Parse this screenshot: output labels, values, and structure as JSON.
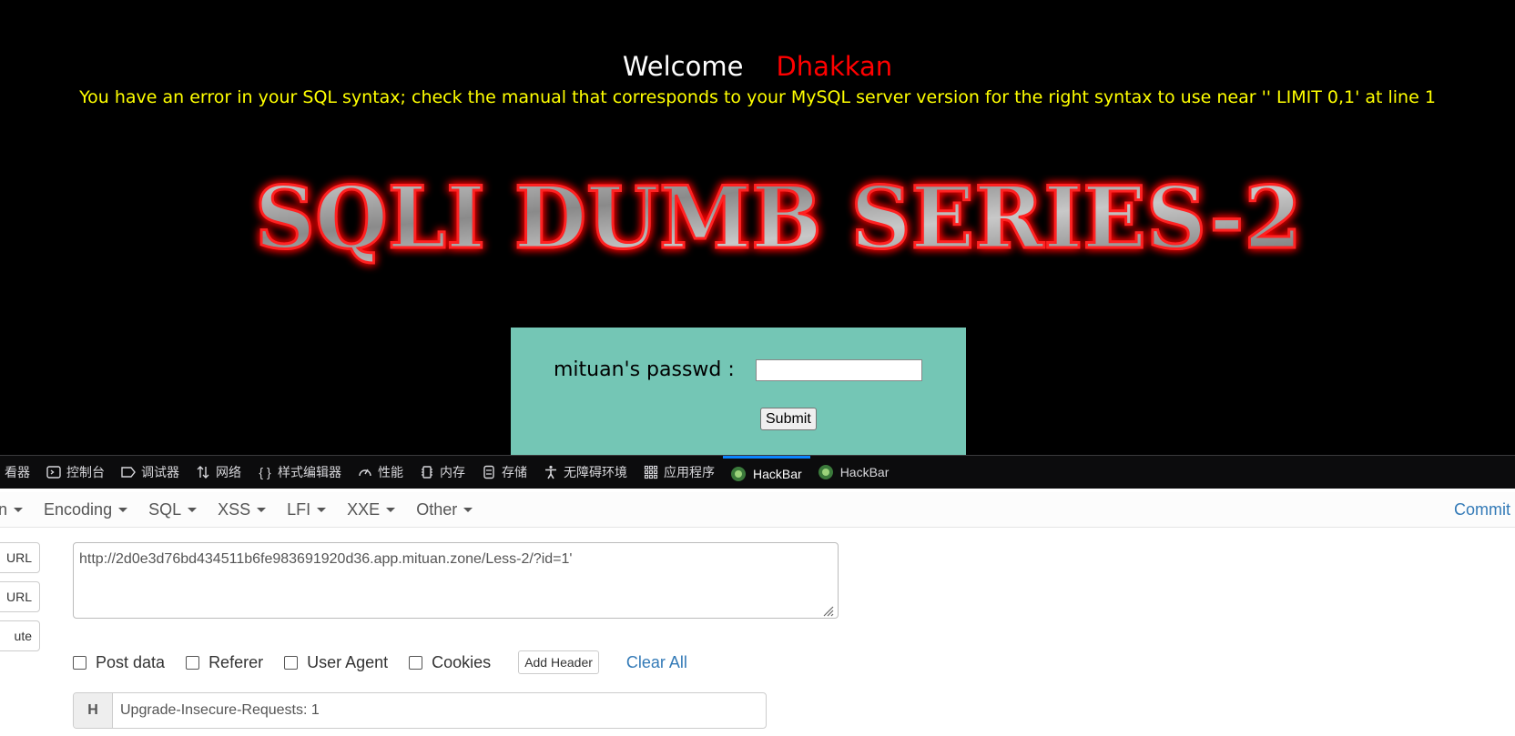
{
  "page": {
    "welcome": "Welcome",
    "user": "Dhakkan",
    "sql_error": "You have an error in your SQL syntax; check the manual that corresponds to your MySQL server version for the right syntax to use near '' LIMIT 0,1' at line 1",
    "logo_text": "SQLI DUMB SERIES-2",
    "passwd_label": "mituan's passwd :",
    "passwd_value": "",
    "submit_label": "Submit"
  },
  "devtools": {
    "tabs": [
      {
        "label": "看器",
        "icon": "inspector-icon"
      },
      {
        "label": "控制台",
        "icon": "console-icon"
      },
      {
        "label": "调试器",
        "icon": "debugger-icon"
      },
      {
        "label": "网络",
        "icon": "network-icon"
      },
      {
        "label": "样式编辑器",
        "icon": "style-editor-icon"
      },
      {
        "label": "性能",
        "icon": "performance-icon"
      },
      {
        "label": "内存",
        "icon": "memory-icon"
      },
      {
        "label": "存储",
        "icon": "storage-icon"
      },
      {
        "label": "无障碍环境",
        "icon": "accessibility-icon"
      },
      {
        "label": "应用程序",
        "icon": "application-icon"
      },
      {
        "label": "HackBar",
        "icon": "hackbar-icon"
      },
      {
        "label": "HackBar",
        "icon": "hackbar-icon"
      }
    ],
    "active_tab_color": "#0a84ff"
  },
  "hackbar": {
    "menu": {
      "first": "n",
      "encoding": "Encoding",
      "sql": "SQL",
      "xss": "XSS",
      "lfi": "LFI",
      "xxe": "XXE",
      "other": "Other",
      "commit": "Commit"
    },
    "side_buttons": {
      "load": "URL",
      "split": "URL",
      "execute": "ute"
    },
    "url": "http://2d0e3d76bd434511b6fe983691920d36.app.mituan.zone/Less-2/?id=1' ",
    "options": {
      "post_data": "Post data",
      "referer": "Referer",
      "user_agent": "User Agent",
      "cookies": "Cookies",
      "add_header": "Add Header",
      "clear_all": "Clear All"
    },
    "header_row": {
      "key": "H",
      "value": "Upgrade-Insecure-Requests: 1"
    }
  }
}
